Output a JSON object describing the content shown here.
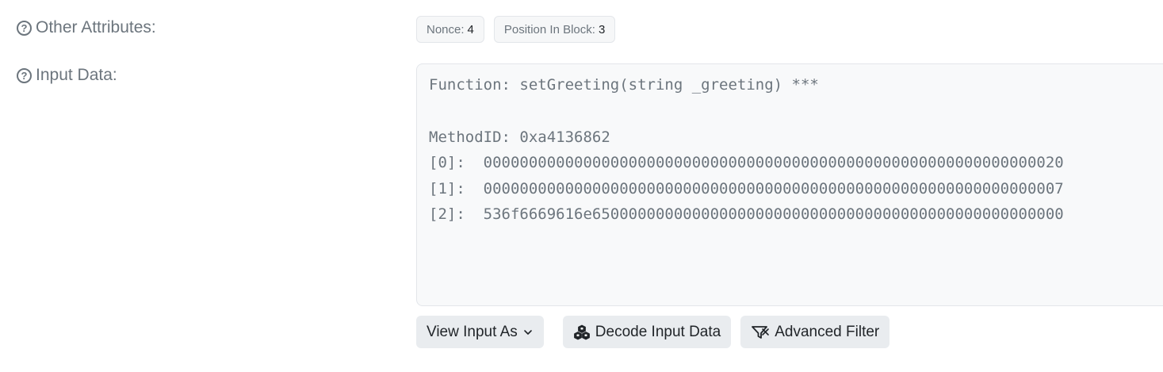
{
  "attributes": {
    "label": "Other Attributes:",
    "nonce_label": "Nonce:",
    "nonce_value": "4",
    "position_label": "Position In Block:",
    "position_value": "3"
  },
  "input_data": {
    "label": "Input Data:",
    "function_line": "Function: setGreeting(string _greeting) ***",
    "method_id_line": "MethodID: 0xa4136862",
    "params": [
      "[0]:  0000000000000000000000000000000000000000000000000000000000000020",
      "[1]:  0000000000000000000000000000000000000000000000000000000000000007",
      "[2]:  536f6669616e6500000000000000000000000000000000000000000000000000"
    ]
  },
  "actions": {
    "view_input_label": "View Input As",
    "decode_label": "Decode Input Data",
    "filter_label": "Advanced Filter"
  },
  "icons": {
    "help": "question-circle-icon",
    "chevron": "chevron-down-icon",
    "decode": "cubes-icon",
    "filter": "filter-icon"
  }
}
